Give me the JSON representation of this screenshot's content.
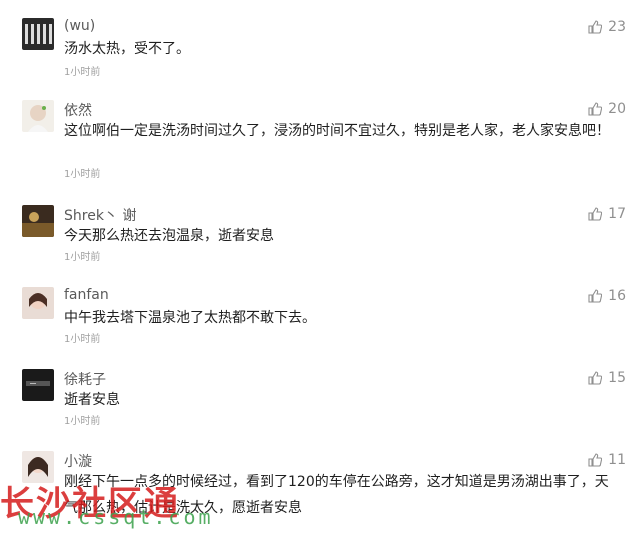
{
  "comments": [
    {
      "name": "(wu)",
      "text": "汤水太热，受不了。",
      "time": "1小时前",
      "likes": "23"
    },
    {
      "name": "依然",
      "text": "这位啊伯一定是洗汤时间过久了，浸汤的时间不宜过久，特别是老人家，老人家安息吧！",
      "time": "1小时前",
      "likes": "20"
    },
    {
      "name": "Shrek丶 谢",
      "text": "今天那么热还去泡温泉，逝者安息",
      "time": "1小时前",
      "likes": "17"
    },
    {
      "name": "fanfan",
      "text": "中午我去塔下温泉池了太热都不敢下去。",
      "time": "1小时前",
      "likes": "16"
    },
    {
      "name": "徐耗子",
      "text": "逝者安息",
      "time": "1小时前",
      "likes": "15"
    },
    {
      "name": "小漩",
      "text": "刚经下午一点多的时候经过，看到了120的车停在公路旁，这才知道是男汤湖出事了，天气那么热，估计是洗太久，愿逝者安息",
      "time": "",
      "likes": "11"
    }
  ],
  "watermark": {
    "text": "长沙社区通",
    "url": "www.cssqt.com"
  }
}
